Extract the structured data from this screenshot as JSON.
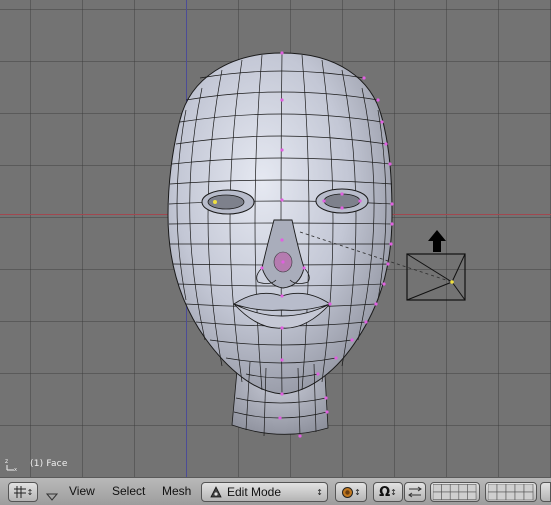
{
  "viewport": {
    "object_label": "(1) Face",
    "grid_color": "#737373",
    "x_axis_color": "#a04850",
    "z_axis_color": "#4c4c96",
    "mesh_color": "#c4c8d6",
    "wire_color": "#1a1a1a",
    "vertex_color": "#e060e0"
  },
  "header": {
    "editor_type_icon": "grid-icon",
    "menu": {
      "view": "View",
      "select": "Select",
      "mesh": "Mesh"
    },
    "mode": {
      "icon": "edit-mode-icon",
      "label": "Edit Mode"
    },
    "shading_icon": "solid-shading-icon",
    "pivot_icon": "pivot-icon",
    "manipulator_icon": "manipulator-icon"
  }
}
